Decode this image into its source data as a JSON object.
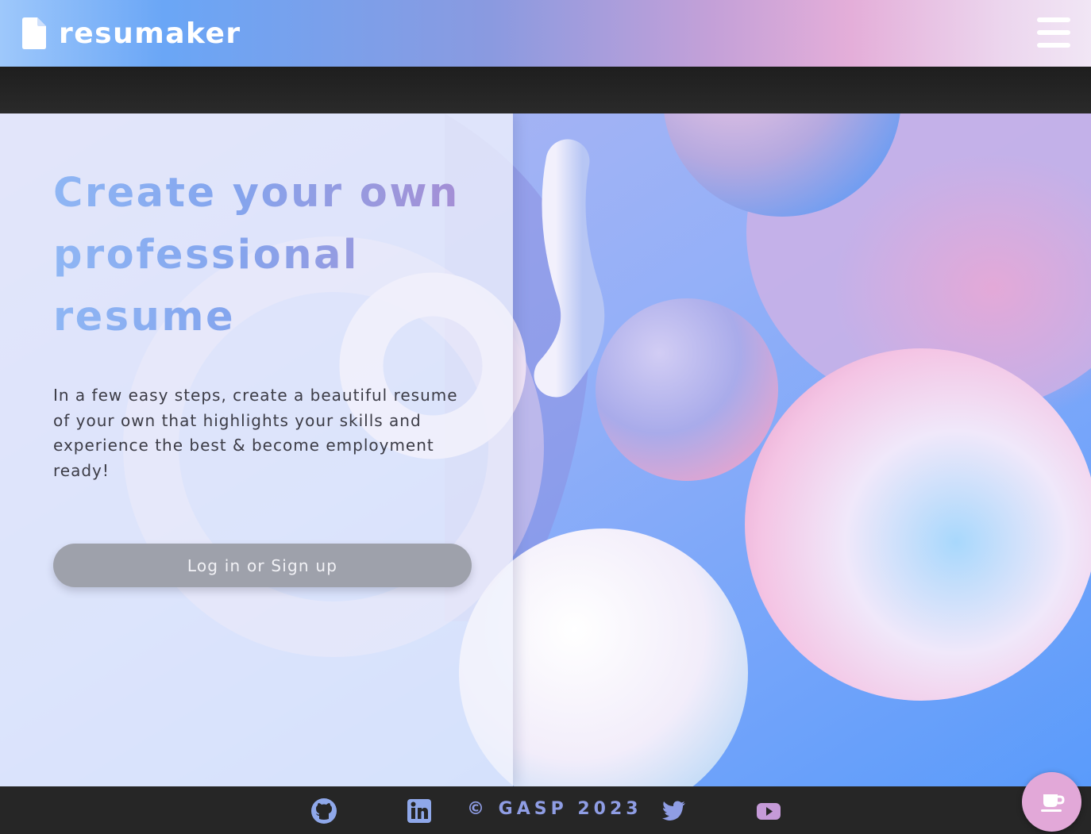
{
  "header": {
    "brand": "resumaker",
    "logo_icon": "document-icon",
    "menu_icon": "hamburger-menu-icon"
  },
  "hero": {
    "headline_lines": [
      "Create your own",
      "professional",
      "resume"
    ],
    "description": "In a few easy steps, create a beautiful resume of your own that highlights your skills and experience the best & become employment ready!",
    "cta_label": "Log in or Sign up"
  },
  "footer": {
    "copyright": "© GASP 2023",
    "icons": [
      "github-icon",
      "linkedin-icon",
      "twitter-icon",
      "youtube-icon"
    ],
    "floating_button_icon": "coffee-cup-icon"
  },
  "colors": {
    "header_gradient_start": "#9ec8fb",
    "header_gradient_end": "#f1e6f5",
    "headline_blue": "#8fb6f4",
    "headline_purple": "#a98ad2",
    "footer_bg": "#262626",
    "footer_accent": "#8f9de4",
    "cta_bg": "#9ea1ab",
    "coffee_button": "#e2a8d8"
  }
}
